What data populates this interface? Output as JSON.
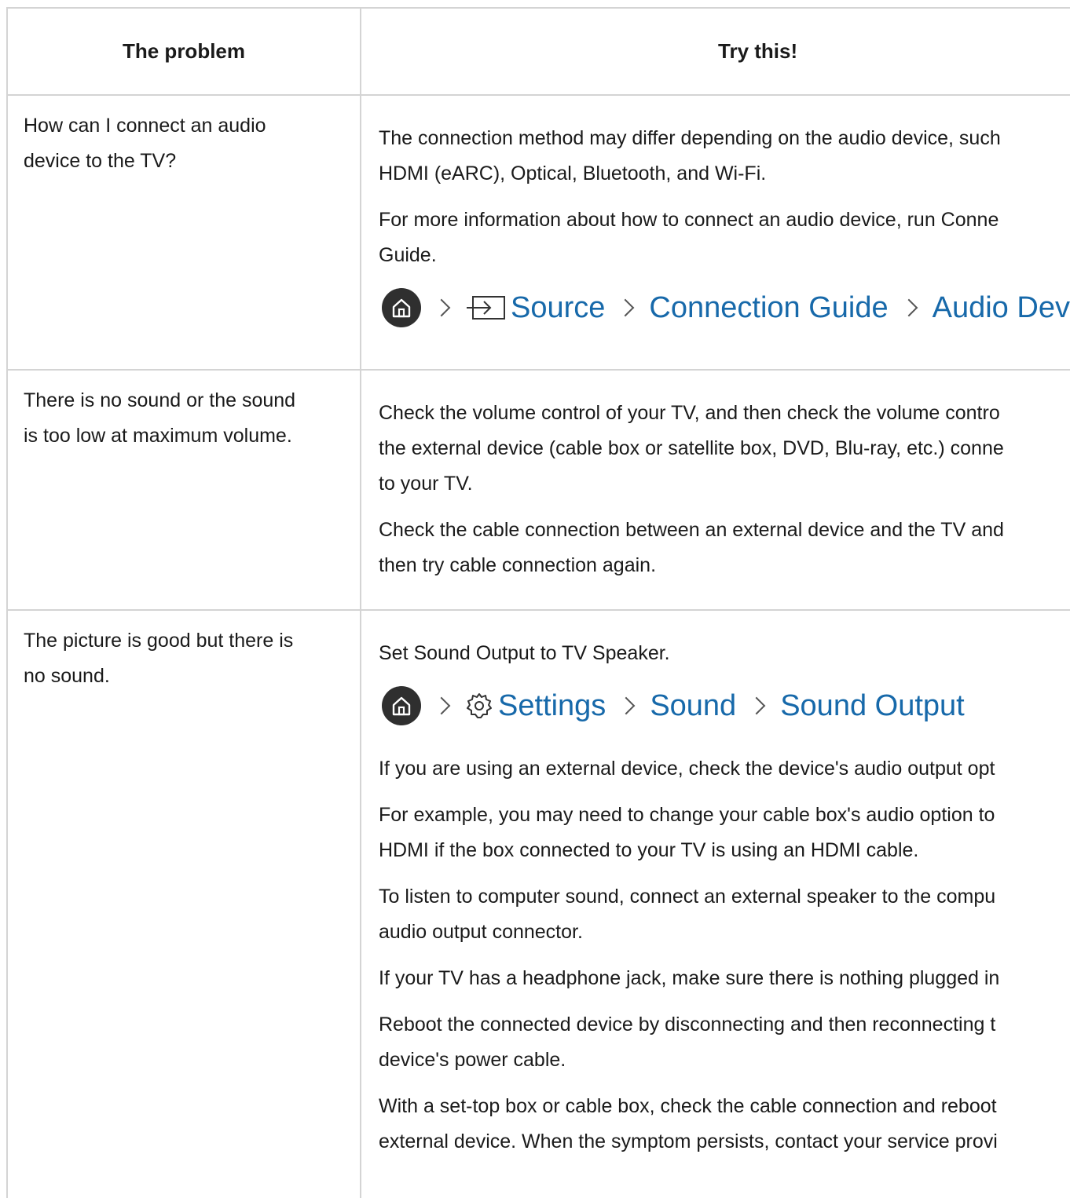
{
  "headers": {
    "problem": "The problem",
    "try": "Try this!"
  },
  "rows": [
    {
      "problem": [
        "How can I connect an audio",
        "device to the TV?"
      ],
      "paragraphs": [
        [
          "The connection method may differ depending on the audio device, such",
          "HDMI (eARC), Optical, Bluetooth, and Wi-Fi."
        ],
        [
          "For more information about how to connect an audio device, run Conne",
          "Guide."
        ]
      ],
      "path": [
        "Source",
        "Connection Guide",
        "Audio Devic"
      ]
    },
    {
      "problem": [
        "There is no sound or the sound",
        "is too low at maximum volume."
      ],
      "paragraphs": [
        [
          "Check the volume control of your TV, and then check the volume contro",
          "the external device (cable box or satellite box, DVD, Blu-ray, etc.) conne",
          "to your TV."
        ],
        [
          "Check the cable connection between an external device and the TV and",
          "then try cable connection again."
        ]
      ]
    },
    {
      "problem": [
        "The picture is good but there is",
        "no sound."
      ],
      "first": "Set Sound Output to TV Speaker.",
      "path": [
        "Settings",
        "Sound",
        "Sound Output"
      ],
      "paragraphs": [
        [
          "If you are using an external device, check the device's audio output opt"
        ],
        [
          "For example, you may need to change your cable box's audio option to",
          "HDMI if the box connected to your TV is using an HDMI cable."
        ],
        [
          "To listen to computer sound, connect an external speaker to the compu",
          "audio output connector."
        ],
        [
          "If your TV has a headphone jack, make sure there is nothing plugged in"
        ],
        [
          "Reboot the connected device by disconnecting and then reconnecting t",
          "device's power cable."
        ],
        [
          "With a set-top box or cable box, check the cable connection and reboot",
          "external device. When the symptom persists, contact your service provi"
        ]
      ]
    }
  ],
  "colors": {
    "link": "#1769aa",
    "border": "#d4d4d4",
    "home_bg": "#2f2f2f"
  }
}
